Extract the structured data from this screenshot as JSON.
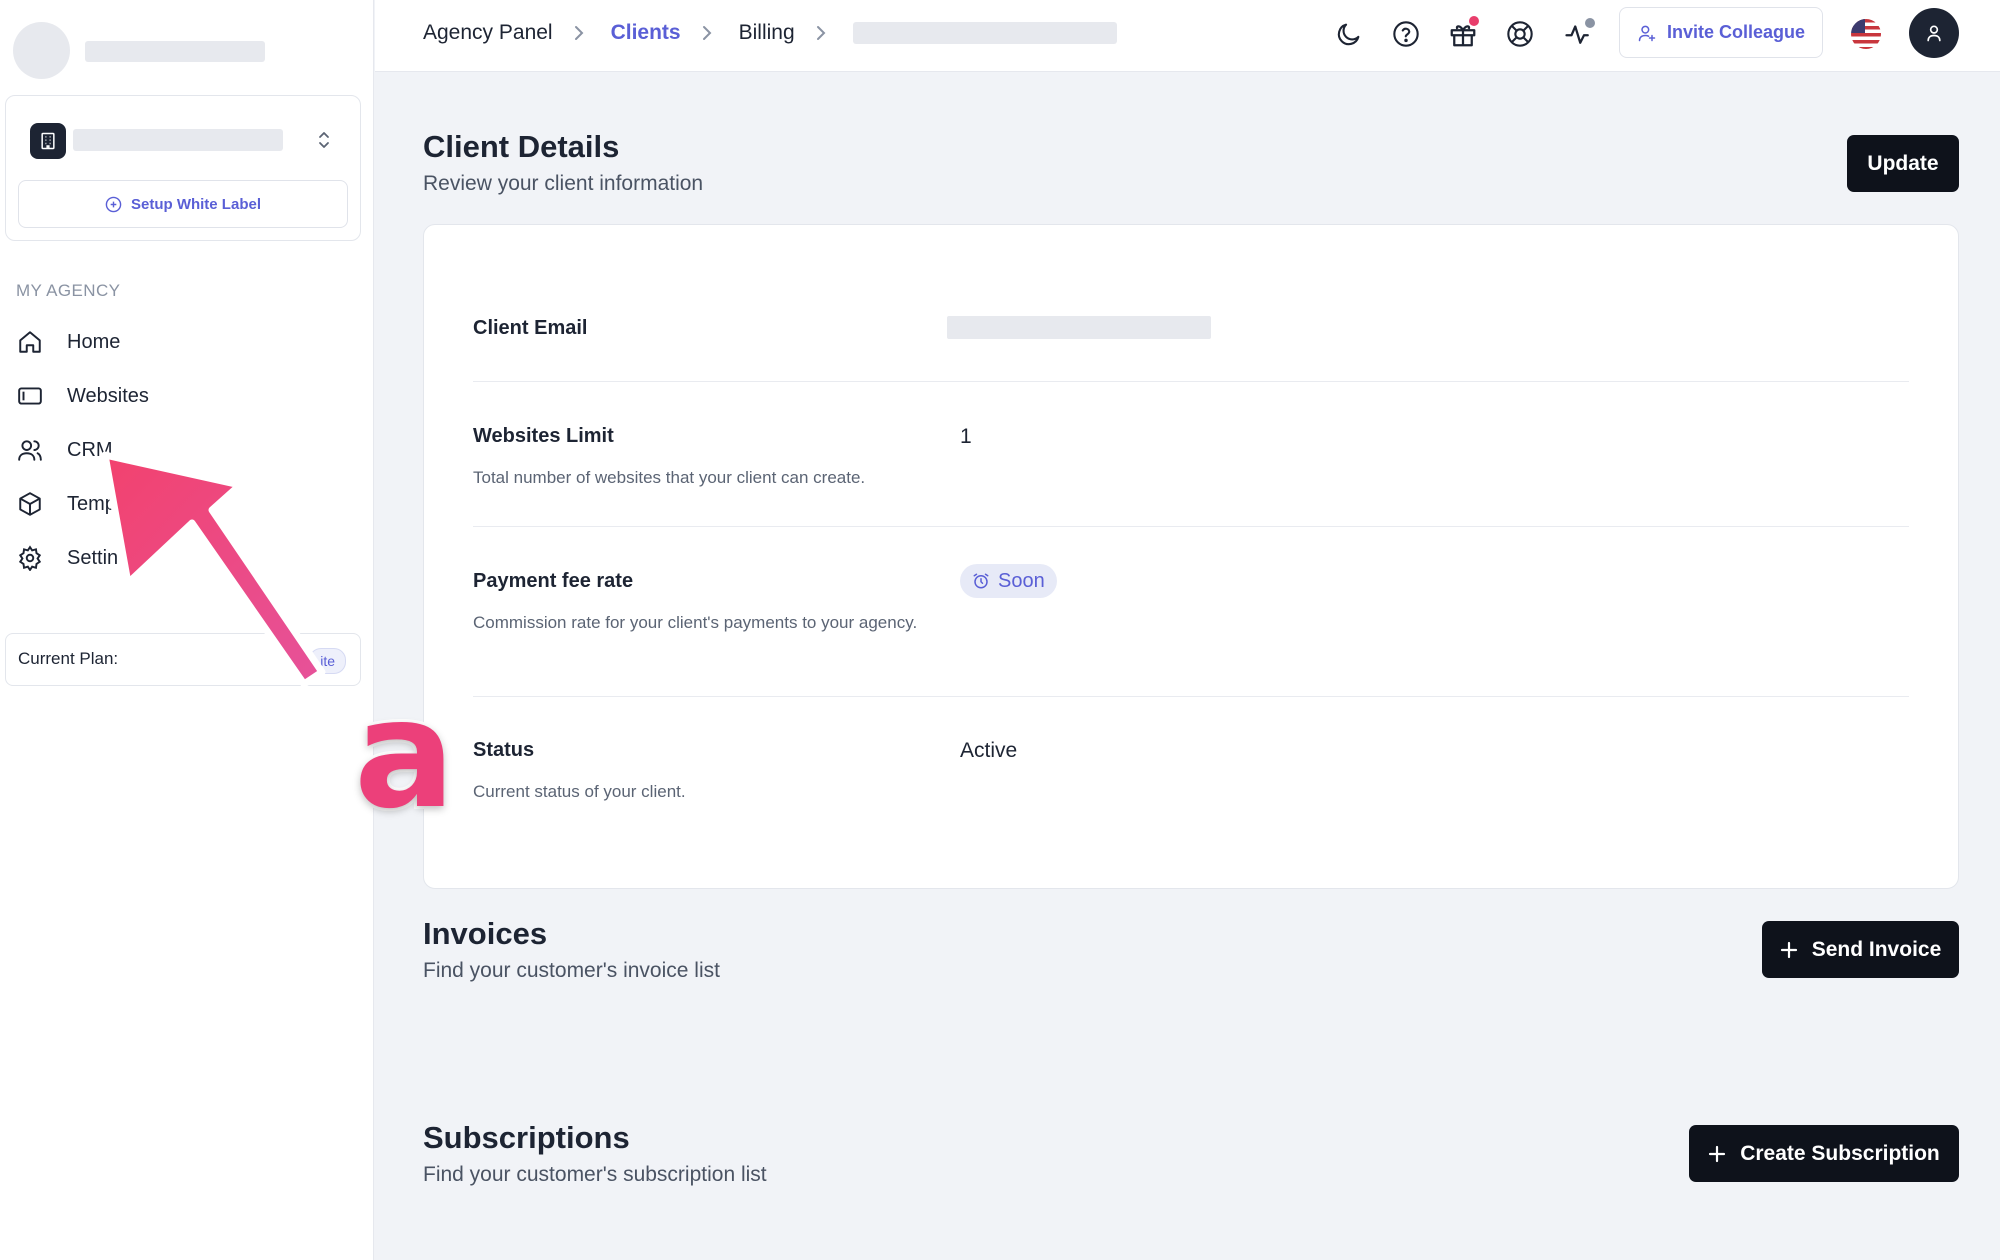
{
  "sidebar": {
    "white_label_button": "Setup White Label",
    "section_label": "MY AGENCY",
    "nav": [
      {
        "label": "Home",
        "icon": "home-icon"
      },
      {
        "label": "Websites",
        "icon": "browser-window-icon"
      },
      {
        "label": "CRM",
        "icon": "users-icon"
      },
      {
        "label": "Temp",
        "icon": "package-icon"
      },
      {
        "label": "Settin",
        "icon": "gear-icon"
      }
    ],
    "plan_label": "Current Plan:",
    "plan_badge": "ite"
  },
  "topbar": {
    "breadcrumbs": [
      "Agency Panel",
      "Clients",
      "Billing"
    ],
    "invite_button": "Invite Colleague",
    "icons": [
      "moon-icon",
      "help-icon",
      "gift-icon",
      "lifebuoy-icon",
      "activity-icon"
    ]
  },
  "client_details": {
    "title": "Client Details",
    "subtitle": "Review your client information",
    "update_button": "Update",
    "rows": {
      "email_label": "Client Email",
      "websites_limit_label": "Websites Limit",
      "websites_limit_desc": "Total number of websites that your client can create.",
      "websites_limit_value": "1",
      "fee_label": "Payment fee rate",
      "fee_desc": "Commission rate for your client's payments to your agency.",
      "fee_badge": "Soon",
      "status_label": "Status",
      "status_desc": "Current status of your client.",
      "status_value": "Active"
    }
  },
  "invoices": {
    "title": "Invoices",
    "subtitle": "Find your customer's invoice list",
    "button": "Send Invoice"
  },
  "subscriptions": {
    "title": "Subscriptions",
    "subtitle": "Find your customer's subscription list",
    "button": "Create Subscription"
  },
  "annotation": {
    "letter": "a",
    "color": "#ec407a"
  },
  "colors": {
    "accent": "#5a5fd6",
    "dark_button": "#0e121b",
    "notification_dot": "#e83e6c"
  }
}
